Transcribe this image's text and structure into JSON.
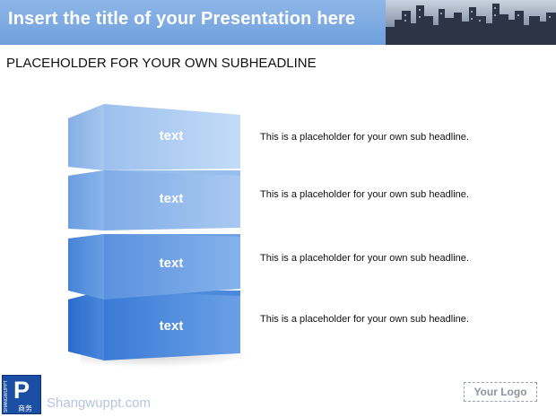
{
  "header": {
    "title": "Insert the title of your Presentation here"
  },
  "subheadline": "PLACEHOLDER FOR YOUR  OWN SUBHEADLINE",
  "blocks": [
    {
      "label": "text",
      "description": "This is a placeholder for your own sub headline."
    },
    {
      "label": "text",
      "description": "This is a placeholder for your own sub headline."
    },
    {
      "label": "text",
      "description": "This is a placeholder for your own sub headline."
    },
    {
      "label": "text",
      "description": "This is a placeholder for your own sub headline."
    }
  ],
  "footer": {
    "brand_vertical": "SHANGWUPPT",
    "brand_letter": "P",
    "brand_chinese": "商务",
    "url": "Shangwuppt.com",
    "logo_placeholder": "Your  Logo"
  },
  "colors": {
    "title_bar": "#7aa8e2",
    "block_top": "#b7d3f4",
    "block_bottom": "#2f78d4"
  }
}
